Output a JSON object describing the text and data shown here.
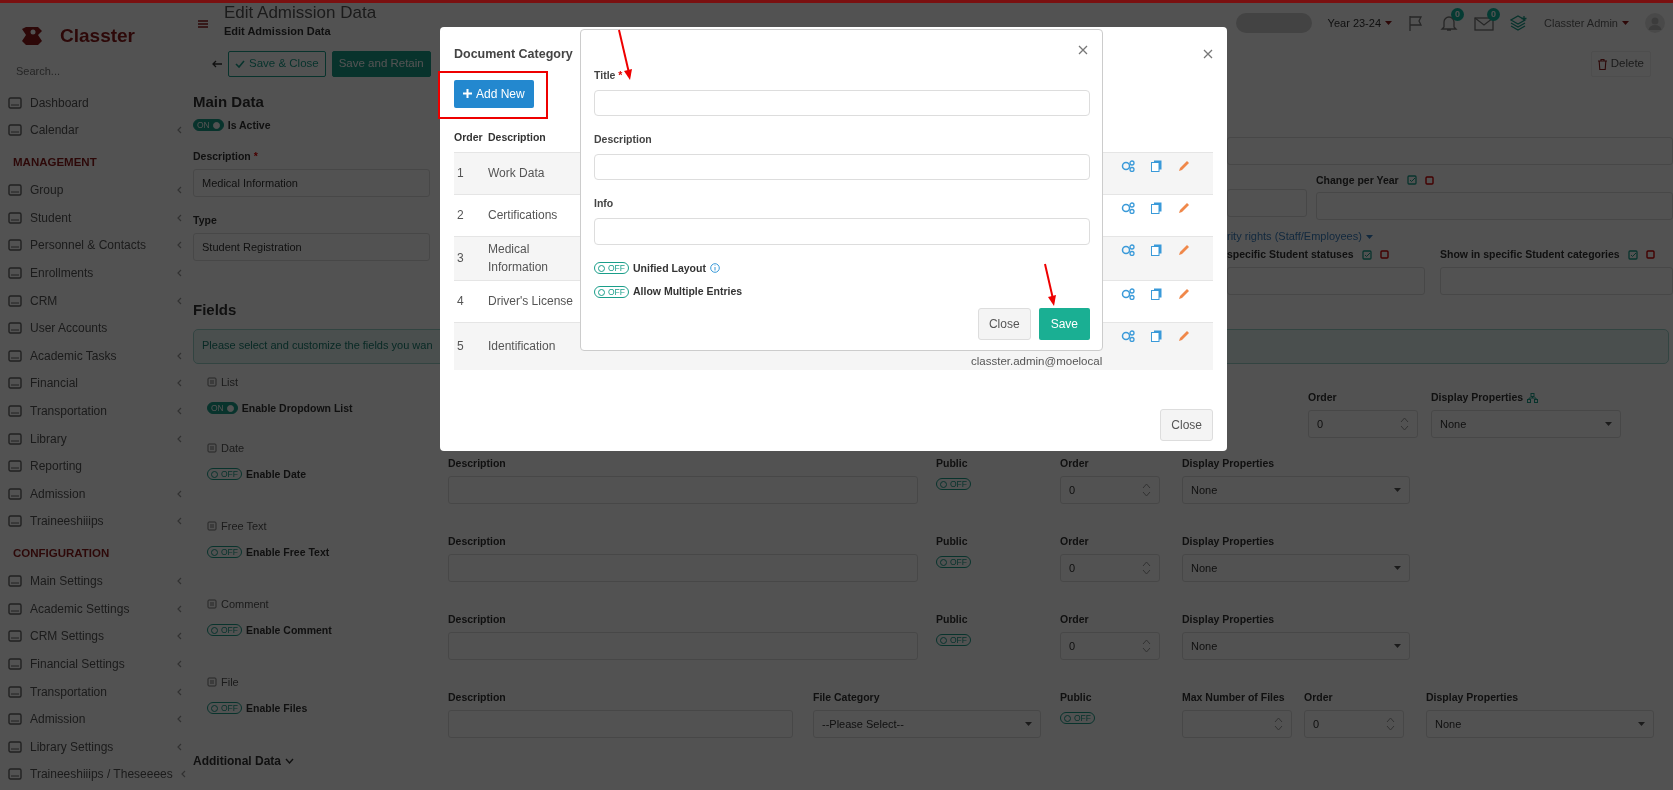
{
  "sidebar": {
    "logo_text": "Classter",
    "search_placeholder": "Search...",
    "items": [
      {
        "label": "Dashboard",
        "expandable": false
      },
      {
        "label": "Calendar",
        "expandable": true
      }
    ],
    "sections": [
      {
        "heading": "MANAGEMENT",
        "items": [
          {
            "label": "Group",
            "expandable": true
          },
          {
            "label": "Student",
            "expandable": true
          },
          {
            "label": "Personnel & Contacts",
            "expandable": true
          },
          {
            "label": "Enrollments",
            "expandable": true
          },
          {
            "label": "CRM",
            "expandable": true
          },
          {
            "label": "User Accounts",
            "expandable": false
          },
          {
            "label": "Academic Tasks",
            "expandable": true
          },
          {
            "label": "Financial",
            "expandable": true
          },
          {
            "label": "Transportation",
            "expandable": true
          },
          {
            "label": "Library",
            "expandable": true
          },
          {
            "label": "Reporting",
            "expandable": false
          },
          {
            "label": "Admission",
            "expandable": true
          },
          {
            "label": "Traineeshiiips",
            "expandable": true
          }
        ]
      },
      {
        "heading": "CONFIGURATION",
        "items": [
          {
            "label": "Main Settings",
            "expandable": true
          },
          {
            "label": "Academic Settings",
            "expandable": true
          },
          {
            "label": "CRM Settings",
            "expandable": true
          },
          {
            "label": "Financial Settings",
            "expandable": true
          },
          {
            "label": "Transportation",
            "expandable": true
          },
          {
            "label": "Admission",
            "expandable": true
          },
          {
            "label": "Library Settings",
            "expandable": true
          },
          {
            "label": "Traineeshiiips / Theseeees",
            "expandable": true
          }
        ]
      }
    ]
  },
  "header": {
    "title": "Edit Admission Data",
    "subtitle": "Edit Admission Data",
    "year": "Year 23-24",
    "notification_count": "0",
    "message_count": "0",
    "user_name": "Classter Admin"
  },
  "toolbar": {
    "buttons": [
      {
        "label": "Save & Close",
        "kind": "outline"
      },
      {
        "label": "Save and Retain",
        "kind": "solid"
      }
    ],
    "delete_label": "Delete"
  },
  "main_data": {
    "heading": "Main Data",
    "active_toggle": {
      "on": true,
      "text": "ON"
    },
    "active_label": "Is Active",
    "description_label": "Description",
    "description_required_mark": "*",
    "description_value": "Medical Information",
    "type_label": "Type",
    "type_value": "Student Registration",
    "change_per_year_label": "Change per Year",
    "security_link": "rity rights (Staff/Employees)",
    "statuses_label": "specific Student statuses",
    "categories_label": "Show in specific Student categories"
  },
  "fields_section": {
    "heading": "Fields",
    "info_text": "Please select and customize the fields you wan",
    "list_field": {
      "title": "List",
      "toggle": {
        "on": true,
        "text": "ON"
      },
      "enable_label": "Enable Dropdown List",
      "order_label": "Order",
      "order_value": "0",
      "display_label": "Display Properties",
      "display_value": "None"
    },
    "rows": [
      {
        "kind": "standard",
        "title": "Date",
        "toggle": {
          "on": false,
          "text": "OFF"
        },
        "enable_label": "Enable Date",
        "description_label": "Description",
        "public_label": "Public",
        "public_toggle": {
          "on": false,
          "text": "OFF"
        },
        "order_label": "Order",
        "order_value": "0",
        "display_label": "Display Properties",
        "display_value": "None"
      },
      {
        "kind": "standard",
        "title": "Free Text",
        "toggle": {
          "on": false,
          "text": "OFF"
        },
        "enable_label": "Enable Free Text",
        "description_label": "Description",
        "public_label": "Public",
        "public_toggle": {
          "on": false,
          "text": "OFF"
        },
        "order_label": "Order",
        "order_value": "0",
        "display_label": "Display Properties",
        "display_value": "None"
      },
      {
        "kind": "standard",
        "title": "Comment",
        "toggle": {
          "on": false,
          "text": "OFF"
        },
        "enable_label": "Enable Comment",
        "description_label": "Description",
        "public_label": "Public",
        "public_toggle": {
          "on": false,
          "text": "OFF"
        },
        "order_label": "Order",
        "order_value": "0",
        "display_label": "Display Properties",
        "display_value": "None"
      },
      {
        "kind": "file",
        "title": "File",
        "toggle": {
          "on": false,
          "text": "OFF"
        },
        "enable_label": "Enable Files",
        "description_label": "Description",
        "file_category_label": "File Category",
        "file_category_value": "--Please Select--",
        "public_label": "Public",
        "public_toggle": {
          "on": false,
          "text": "OFF"
        },
        "max_files_label": "Max Number of Files",
        "order_label": "Order",
        "order_value": "0",
        "display_label": "Display Properties",
        "display_value": "None"
      }
    ]
  },
  "additional_data": "Additional Data",
  "document_modal": {
    "title": "Document Category",
    "add_button": "Add New",
    "columns": [
      "Order",
      "Description"
    ],
    "rows": [
      {
        "order": "1",
        "description": "Work Data"
      },
      {
        "order": "2",
        "description": "Certifications"
      },
      {
        "order": "3",
        "description": "Medical Information"
      },
      {
        "order": "4",
        "description": "Driver's License"
      },
      {
        "order": "5",
        "description": "Identification",
        "extra": "classter.admin@moelocal"
      }
    ],
    "close_button": "Close"
  },
  "add_modal": {
    "fields": [
      {
        "label": "Title",
        "required_mark": "*"
      },
      {
        "label": "Description"
      },
      {
        "label": "Info"
      }
    ],
    "toggles": [
      {
        "label": "Unified Layout",
        "on": false,
        "text": "OFF",
        "info": true
      },
      {
        "label": "Allow Multiple Entries",
        "on": false,
        "text": "OFF"
      }
    ],
    "close_button": "Close",
    "save_button": "Save"
  }
}
